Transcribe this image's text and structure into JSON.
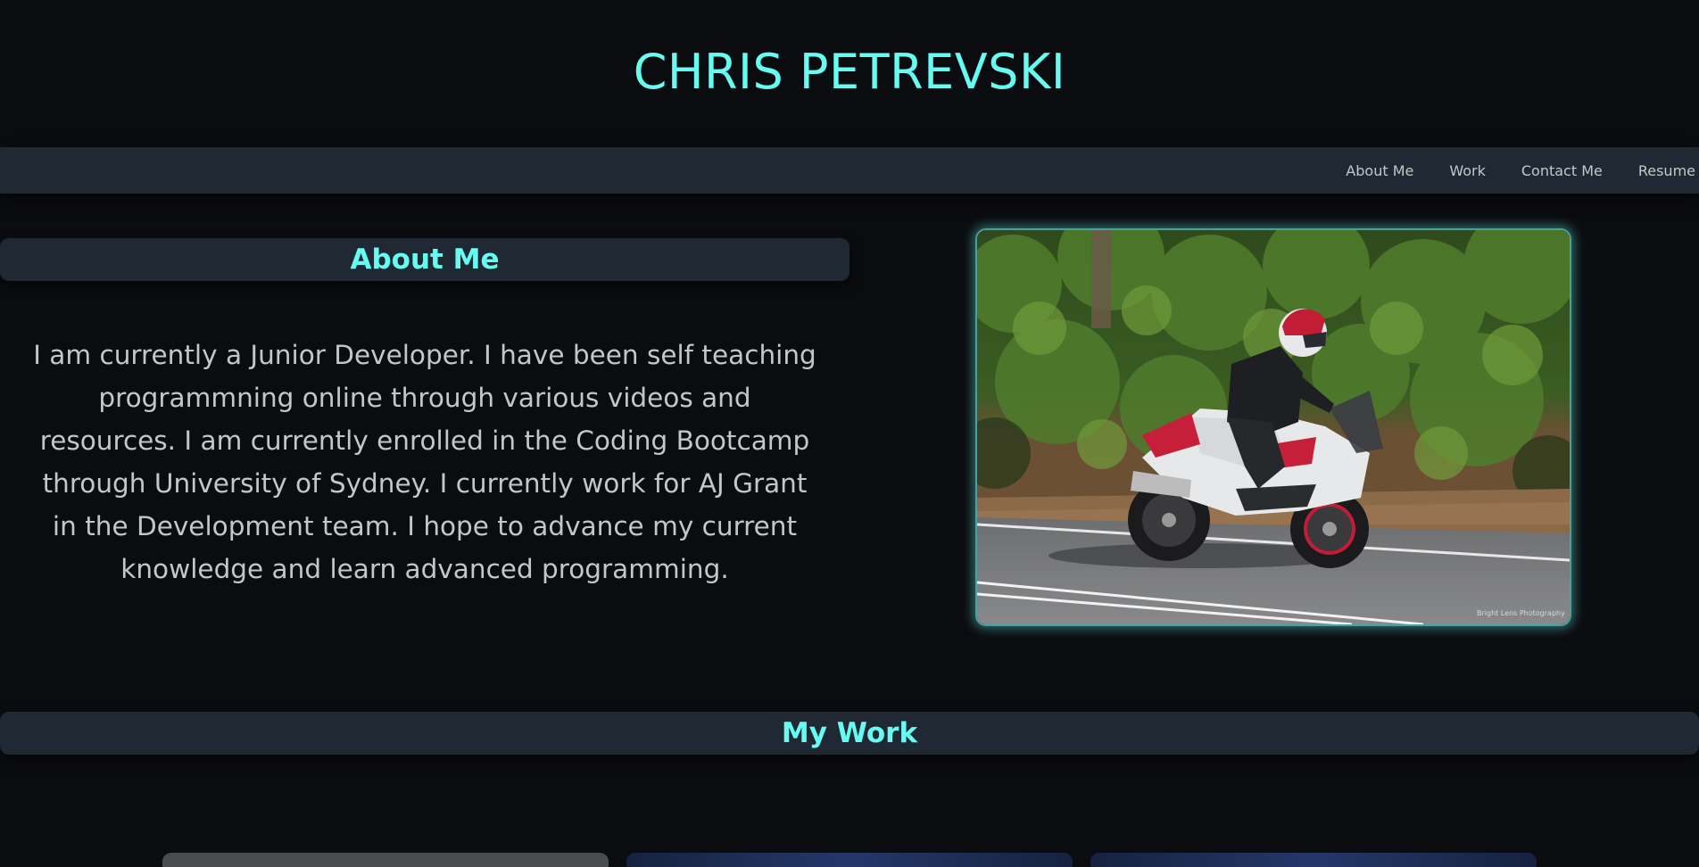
{
  "header": {
    "title": "CHRIS PETREVSKI"
  },
  "nav": {
    "items": [
      {
        "label": "About Me"
      },
      {
        "label": "Work"
      },
      {
        "label": "Contact Me"
      },
      {
        "label": "Resume"
      }
    ]
  },
  "about": {
    "heading": "About Me",
    "body": "I am currently a Junior Developer. I have been self teaching programmning online through various videos and resources. I am currently enrolled in the Coding Bootcamp through University of Sydney. I currently work for AJ Grant in the Development team. I hope to advance my current knowledge and learn advanced programming.",
    "photo": {
      "subject": "rider on red and white sport motorcycle on road",
      "watermark": "Bright Lens Photography"
    }
  },
  "work": {
    "heading": "My Work"
  },
  "colors": {
    "background": "#0b0c10",
    "panel": "#1f2833",
    "accent": "#66fcf1",
    "text": "#c5c6c7",
    "photo_glow": "#45a29e"
  }
}
